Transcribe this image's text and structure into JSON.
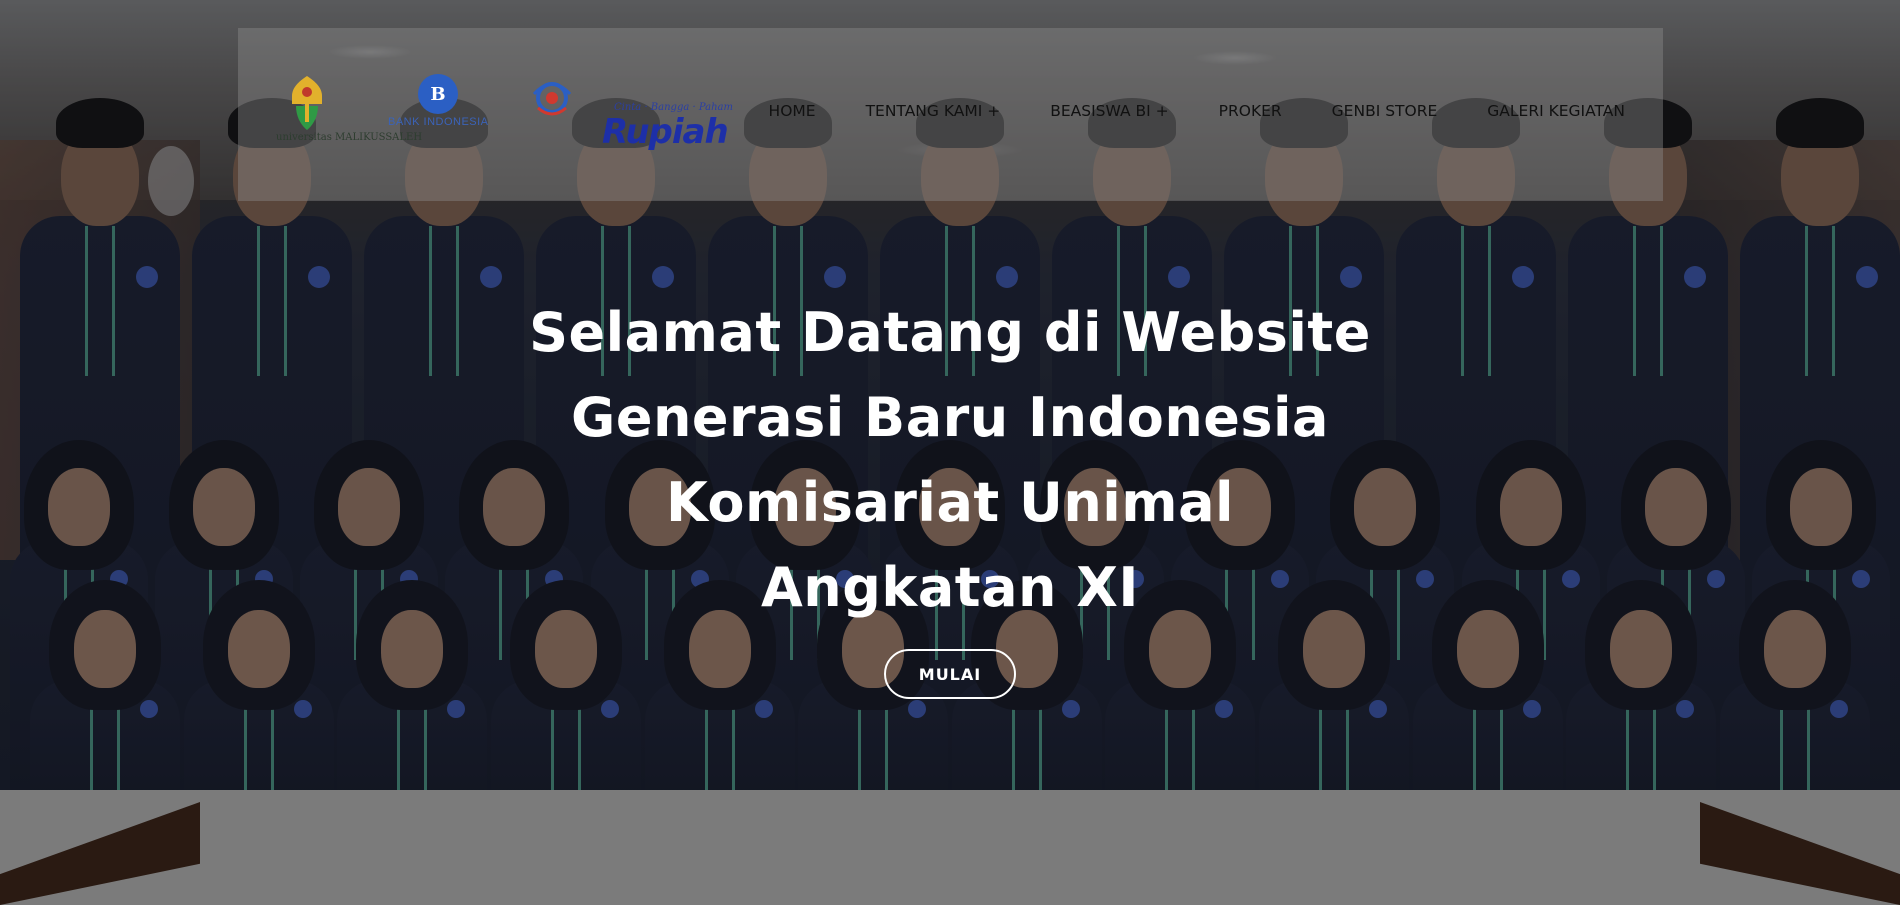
{
  "header": {
    "logos": {
      "university": {
        "name": "universitas MALIKUSSALEH"
      },
      "bank": {
        "monogram": "B",
        "name": "BANK INDONESIA"
      },
      "genbi": {},
      "rupiah": {
        "tagline": "Cinta · Bangga · Paham",
        "word": "Rupiah"
      }
    },
    "nav": [
      {
        "label": "HOME"
      },
      {
        "label": "TENTANG KAMI +"
      },
      {
        "label": "BEASISWA BI +"
      },
      {
        "label": "PROKER"
      },
      {
        "label": "GENBI STORE"
      },
      {
        "label": "GALERI KEGIATAN"
      }
    ]
  },
  "hero": {
    "title_lines": [
      "Selamat Datang di Website",
      "Generasi Baru Indonesia",
      "Komisariat Unimal",
      "Angkatan XI"
    ],
    "cta_label": "MULAI"
  },
  "colors": {
    "overlay": "#0a0c12",
    "header_bg": "#8c8c8c",
    "nav_text": "#111111",
    "hero_text": "#ffffff",
    "uniform": "#1f2438",
    "deco": "#2a1a12"
  }
}
